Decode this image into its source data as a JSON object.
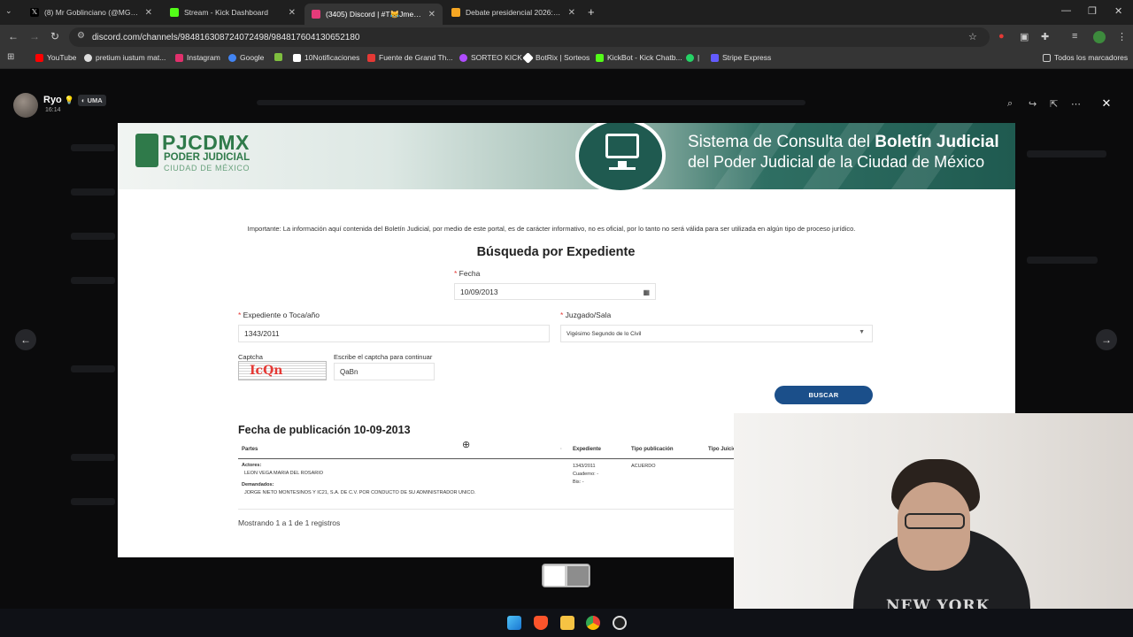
{
  "browser": {
    "tabs": [
      {
        "title": "(8) Mr Goblinciano (@MGoblinc",
        "color": "#ffffff",
        "active": false
      },
      {
        "title": "Stream - Kick Dashboard",
        "color": "#53fc18",
        "active": false
      },
      {
        "title": "(3405) Discord | #T😹Jmemes",
        "color": "#5865f2",
        "active": true
      },
      {
        "title": "Debate presidencial 2026: hoy s",
        "color": "#f5a623",
        "active": false
      }
    ],
    "url": "discord.com/channels/984816308724072498/984817604130652180",
    "bookmarks": [
      {
        "label": "YouTube",
        "color": "#ff0000"
      },
      {
        "label": "pretium iustum mat...",
        "color": "#dddddd"
      },
      {
        "label": "Instagram",
        "color": "#e1306c"
      },
      {
        "label": "Google",
        "color": "#4285f4"
      },
      {
        "label": "",
        "color": "#7fbf3f"
      },
      {
        "label": "10Notificaciones",
        "color": "#ffffff"
      },
      {
        "label": "Fuente de Grand Th...",
        "color": "#e53935"
      },
      {
        "label": "SORTEO KICK",
        "color": "#b04cff"
      },
      {
        "label": "BotRix | Sorteos",
        "color": "#ffffff"
      },
      {
        "label": "KickBot - Kick Chatb...",
        "color": "#53fc18"
      },
      {
        "label": "|",
        "color": "#25d366"
      },
      {
        "label": "Stripe Express",
        "color": "#635bff"
      }
    ],
    "all_bookmarks": "Todos los marcadores"
  },
  "viewer": {
    "username": "Ryo",
    "emoji": "💡",
    "badge": "UMA",
    "time": "16:14"
  },
  "page": {
    "banner_line1_prefix": "Sistema de Consulta del",
    "banner_line1_bold": "Boletín Judicial",
    "banner_line2": "del Poder Judicial de la Ciudad de México",
    "logo_main": "PJCDMX",
    "logo_sub1": "PODER JUDICIAL",
    "logo_sub2": "CIUDAD DE MÉXICO",
    "notice": "Importante: La información aquí contenida del Boletín Judicial, por medio de este portal, es de carácter informativo, no es oficial, por lo tanto no será válida para ser utilizada en algún tipo de proceso jurídico.",
    "form_title": "Búsqueda por Expediente",
    "fecha_label": "Fecha",
    "fecha_value": "10/09/2013",
    "expediente_label": "Expediente o Toca/año",
    "expediente_value": "1343/2011",
    "juzgado_label": "Juzgado/Sala",
    "juzgado_value": "Vigésimo Segundo de lo Civil",
    "captcha_label": "Captcha",
    "captcha_text": "IcQn",
    "captcha_input_label": "Escribe el captcha para continuar",
    "captcha_input_value": "QaBn",
    "search_button": "BUSCAR",
    "pub_title": "Fecha de publicación 10-09-2013",
    "table": {
      "headers": [
        "Partes",
        "Expediente",
        "Tipo publicación",
        "Tipo Juicio"
      ],
      "actores_label": "Actores:",
      "actores_value": "LEON VEGA MARIA DEL ROSARIO",
      "demandados_label": "Demandados:",
      "demandados_value": "JORGE NIETO MONTESINOS Y IC21, S.A. DE C.V. POR CONDUCTO DE SU ADMINISTRADOR UNICO.",
      "expediente_lines": [
        "1343/2011",
        "Cuaderno: -",
        "Bis: -"
      ],
      "tipo_publicacion": "ACUERDO"
    },
    "showing": "Mostrando 1 a 1 de 1 registros"
  },
  "webcam": {
    "shirt_text": "NEW YORK"
  }
}
